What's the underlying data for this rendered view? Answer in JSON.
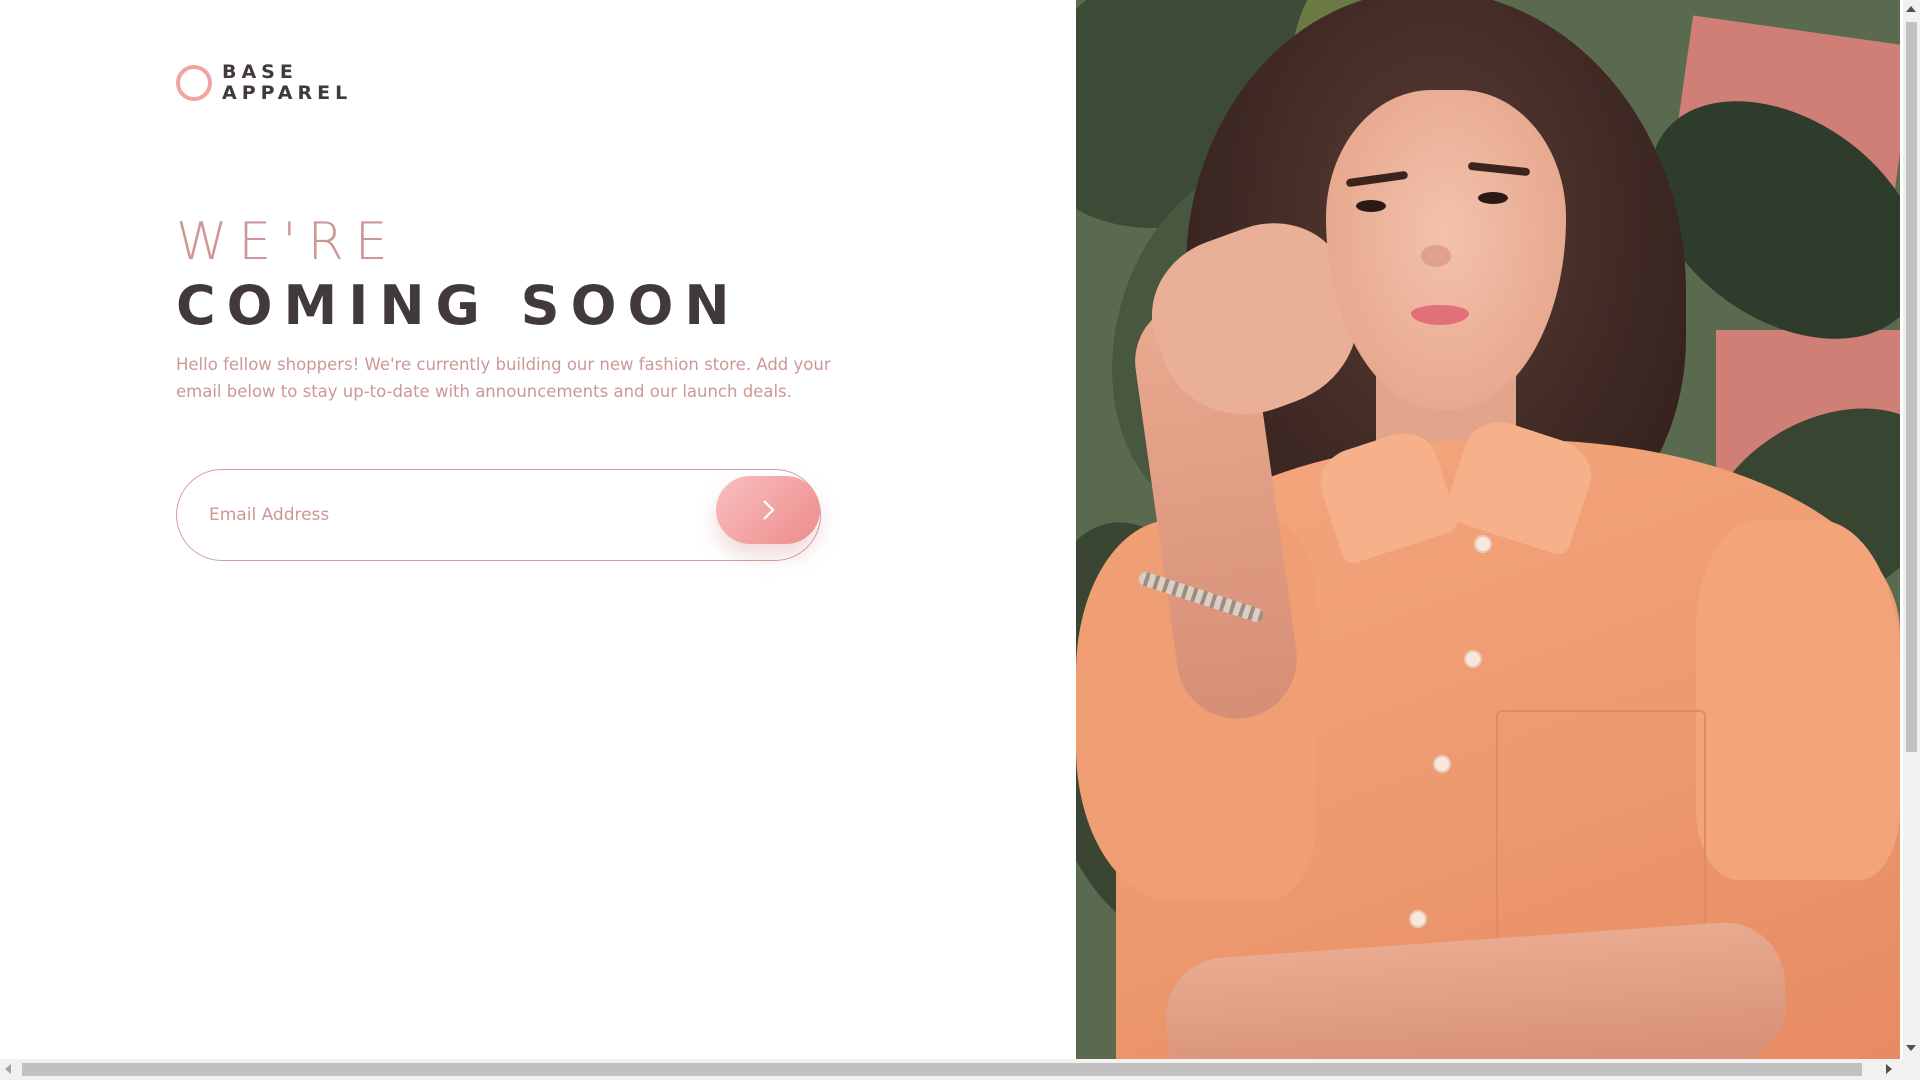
{
  "brand": {
    "line1": "BASE",
    "line2": "APPAREL",
    "accent_color": "#f0a4a4",
    "text_color": "#423a3a"
  },
  "hero": {
    "line_light": "WE'RE",
    "line_bold": "COMING SOON",
    "light_color": "#ce9797",
    "bold_color": "#423a3a"
  },
  "intro": {
    "text": "Hello fellow shoppers! We're currently building our new fashion store. Add your email below to stay up-to-date with announcements and our launch deals."
  },
  "signup": {
    "placeholder": "Email Address",
    "value": "",
    "submit_icon": "chevron-right-icon",
    "border_color": "#d99c9c",
    "button_gradient": [
      "#f8bfbf",
      "#ee8b8b"
    ]
  },
  "image": {
    "description_icon": "hero-photo"
  }
}
